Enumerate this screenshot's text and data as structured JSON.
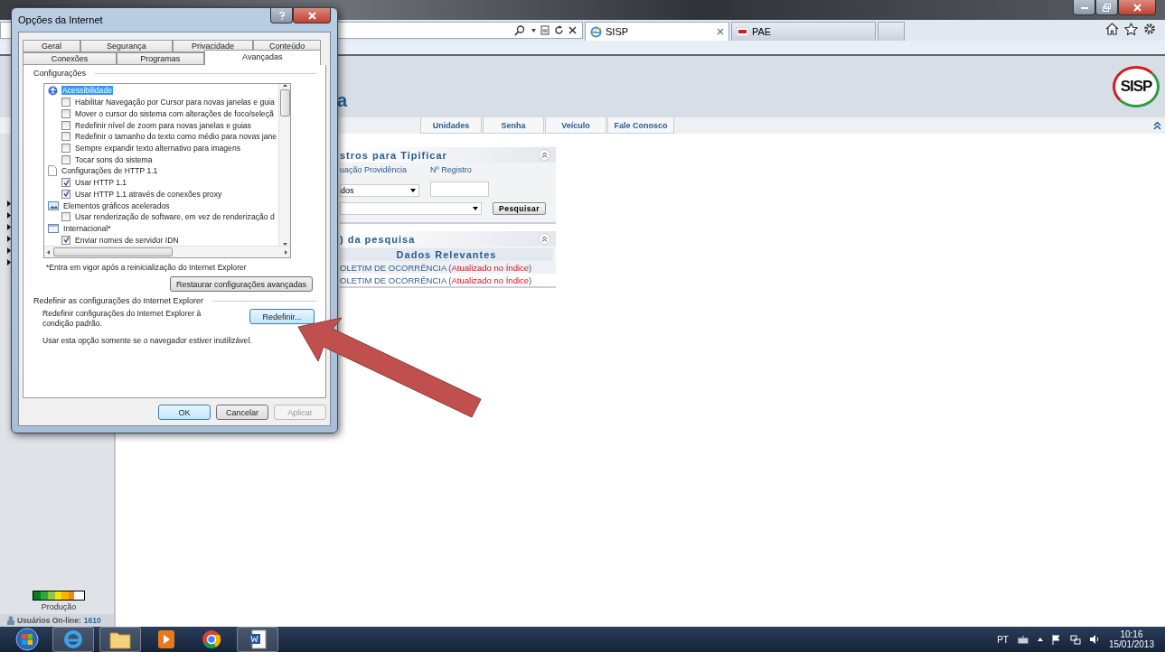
{
  "browser": {
    "tabs": [
      {
        "label": "SISP",
        "selected": true,
        "kind": "ie"
      },
      {
        "label": "PAE",
        "selected": false,
        "kind": "pae"
      }
    ]
  },
  "site": {
    "header_title": "a",
    "logo_text": "SISP",
    "nav": [
      "Unidades",
      "Senha",
      "Veículo",
      "Fale Conosco"
    ]
  },
  "search_panel": {
    "title": "stros para Tipificar",
    "situation_label": "uação Providência",
    "situation_value": "dos",
    "registro_label": "Nº Registro",
    "button": "Pesquisar"
  },
  "results_panel": {
    "title": ") da pesquisa",
    "column": "Dados Relevantes",
    "rows": [
      {
        "text": "OLETIM DE OCORRÊNCIA (",
        "status": "Atualizado no Índice",
        "tail": ")"
      },
      {
        "text": "OLETIM DE OCORRÊNCIA (",
        "status": "Atualizado no Índice",
        "tail": ")"
      }
    ]
  },
  "sidebar": {
    "legend_label": "Produção",
    "users_label": "Usuários On-line:",
    "users_count": "1610"
  },
  "dialog": {
    "title": "Opções da Internet",
    "tab_rows": [
      [
        {
          "label": "Geral",
          "selected": false
        },
        {
          "label": "Segurança",
          "selected": false
        },
        {
          "label": "Privacidade",
          "selected": false
        },
        {
          "label": "Conteúdo",
          "selected": false
        }
      ],
      [
        {
          "label": "Conexões",
          "selected": false
        },
        {
          "label": "Programas",
          "selected": false
        },
        {
          "label": "Avançadas",
          "selected": true
        }
      ]
    ],
    "settings_label": "Configurações",
    "settings": [
      {
        "kind": "accessibility",
        "label": "Acessibilidade",
        "selected": true,
        "children": [
          {
            "label": "Habilitar Navegação por Cursor para novas janelas e guia",
            "checked": false,
            "selected": false
          },
          {
            "label": "Mover o cursor do sistema com alterações de foco/seleçã",
            "checked": false,
            "selected": false
          },
          {
            "label": "Redefinir nível de zoom para novas janelas e guias",
            "checked": false,
            "selected": false
          },
          {
            "label": "Redefinir o tamanho do texto como médio para novas jane",
            "checked": false,
            "selected": false
          },
          {
            "label": "Sempre expandir texto alternativo para imagens",
            "checked": false,
            "selected": false
          },
          {
            "label": "Tocar sons do sistema",
            "checked": false,
            "selected": false
          }
        ]
      },
      {
        "kind": "document",
        "label": "Configurações de HTTP 1.1",
        "selected": false,
        "children": [
          {
            "label": "Usar HTTP 1.1",
            "checked": true,
            "selected": false
          },
          {
            "label": "Usar HTTP 1.1 através de conexões proxy",
            "checked": true,
            "selected": false
          }
        ]
      },
      {
        "kind": "graphics",
        "label": "Elementos gráficos acelerados",
        "selected": false,
        "children": [
          {
            "label": "Usar renderização de software, em vez de renderização d",
            "checked": false,
            "selected": false
          }
        ]
      },
      {
        "kind": "international",
        "label": "Internacional*",
        "selected": false,
        "children": [
          {
            "label": "Enviar nomes de servidor IDN",
            "checked": true,
            "selected": false
          }
        ]
      }
    ],
    "footnote": "*Entra em vigor após a reinicialização do Internet Explorer",
    "restore_button": "Restaurar configurações avançadas",
    "reset_group_label": "Redefinir as configurações do Internet Explorer",
    "reset_text": "Redefinir configurações do Internet Explorer à condição padrão.",
    "reset_button": "Redefinir...",
    "reset_note": "Usar esta opção somente se o navegador estiver inutilizável.",
    "buttons": [
      {
        "label": "OK",
        "disabled": false,
        "default": true
      },
      {
        "label": "Cancelar",
        "disabled": false,
        "default": false
      },
      {
        "label": "Aplicar",
        "disabled": true,
        "default": false
      }
    ]
  },
  "taskbar": {
    "language": "PT",
    "time": "10:16",
    "date": "15/01/2013"
  }
}
